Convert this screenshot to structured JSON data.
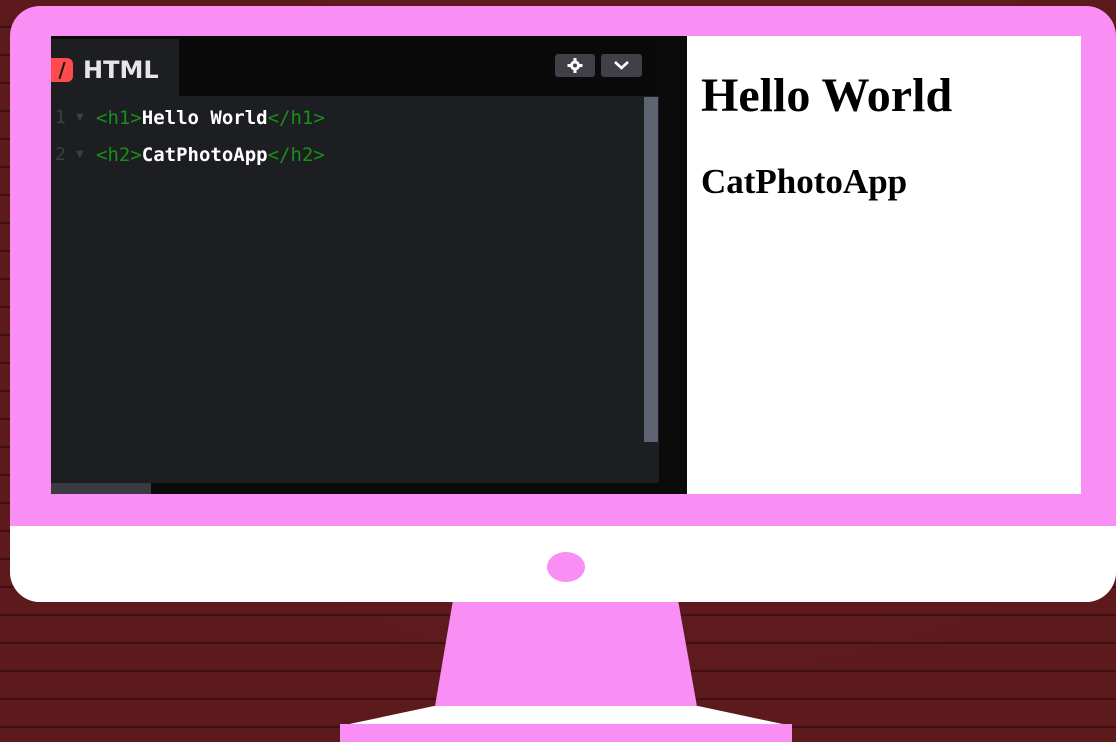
{
  "editor": {
    "tab_label": "HTML",
    "tab_icon": "/",
    "gear_button_icon": "gear-icon",
    "dropdown_button_icon": "chevron-down-icon",
    "lines": [
      {
        "number": "1",
        "open": "<h1>",
        "text": "Hello World",
        "close": "</h1>"
      },
      {
        "number": "2",
        "open": "<h2>",
        "text": "CatPhotoApp",
        "close": "</h2>"
      }
    ]
  },
  "preview": {
    "h1": "Hello World",
    "h2": "CatPhotoApp"
  },
  "colors": {
    "monitor": "#f98ef4",
    "tag": "#198f19",
    "editor_bg": "#1d1e22",
    "tab_icon": "#ff4b4b"
  }
}
